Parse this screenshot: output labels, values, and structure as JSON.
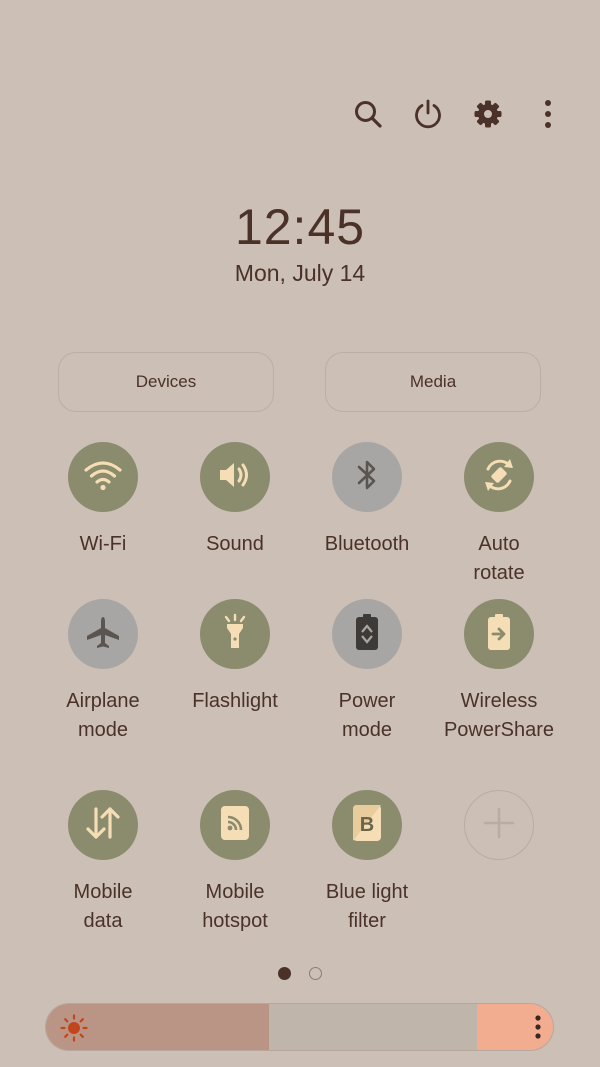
{
  "topbar": {
    "icons": [
      "search-icon",
      "power-icon",
      "settings-gear-icon",
      "more-vertical-icon"
    ]
  },
  "clock": {
    "time": "12:45",
    "date": "Mon, July 14"
  },
  "pills": {
    "devices": "Devices",
    "media": "Media"
  },
  "tiles": [
    {
      "label": "Wi-Fi",
      "state": "on",
      "icon": "wifi-icon"
    },
    {
      "label": "Sound",
      "state": "on",
      "icon": "speaker-icon"
    },
    {
      "label": "Bluetooth",
      "state": "off",
      "icon": "bluetooth-icon"
    },
    {
      "label": "Auto\nrotate",
      "state": "on",
      "icon": "auto-rotate-icon"
    },
    {
      "label": "Airplane\nmode",
      "state": "off",
      "icon": "airplane-icon"
    },
    {
      "label": "Flashlight",
      "state": "on",
      "icon": "flashlight-icon"
    },
    {
      "label": "Power\nmode",
      "state": "off",
      "icon": "battery-recycle-icon"
    },
    {
      "label": "Wireless\nPowerShare",
      "state": "on",
      "icon": "battery-share-icon"
    },
    {
      "label": "Mobile\ndata",
      "state": "on",
      "icon": "data-arrows-icon"
    },
    {
      "label": "Mobile\nhotspot",
      "state": "on",
      "icon": "hotspot-icon"
    },
    {
      "label": "Blue light\nfilter",
      "state": "on",
      "icon": "blue-light-filter-icon"
    },
    {
      "label": "",
      "state": "add",
      "icon": "add-icon"
    }
  ],
  "pager": {
    "current_page": 1,
    "total_pages": 2
  },
  "brightness": {
    "level": 0.44,
    "icon": "sun-icon"
  },
  "colors": {
    "background": "#ccbfb5",
    "tile_on": "#8b8b6e",
    "tile_off": "#a8a6a4",
    "text": "#4a3228",
    "brightness_fill": "#ba9585",
    "brightness_end": "#f2ac90"
  }
}
